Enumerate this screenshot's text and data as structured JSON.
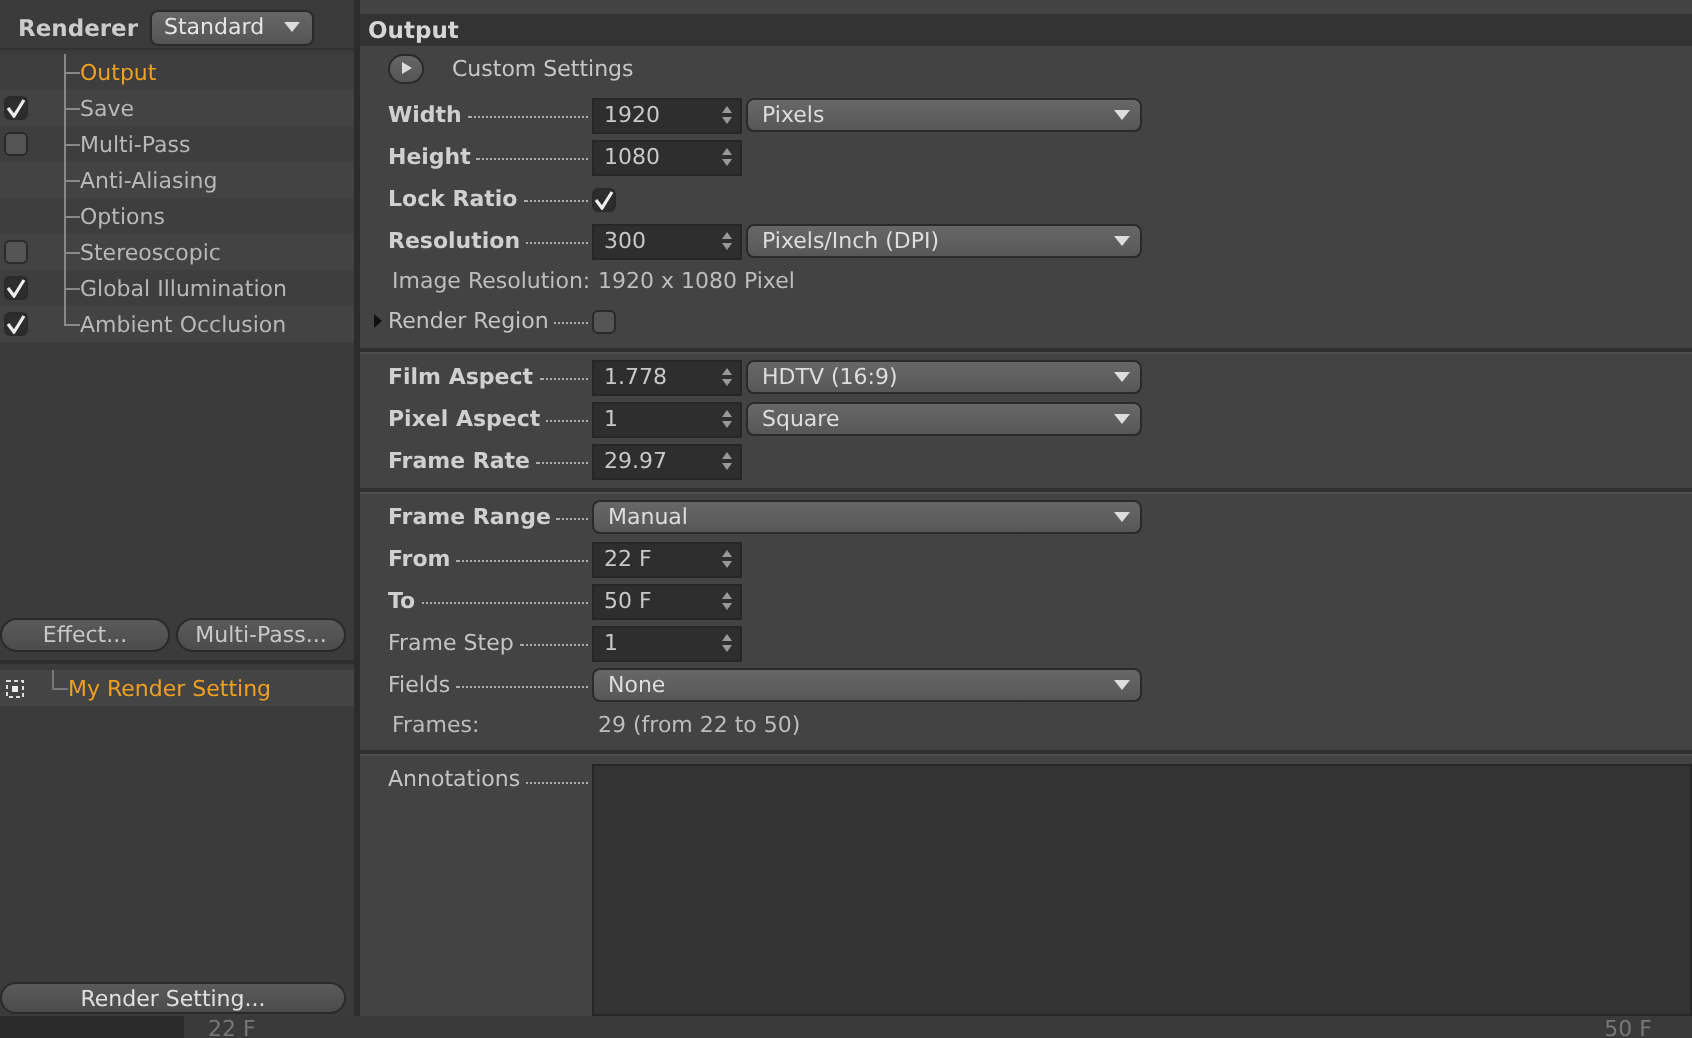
{
  "renderer": {
    "label": "Renderer",
    "value": "Standard"
  },
  "tree": [
    {
      "label": "Output",
      "selected": true
    },
    {
      "label": "Save",
      "selected": false,
      "checked": true
    },
    {
      "label": "Multi-Pass",
      "selected": false,
      "checked": false
    },
    {
      "label": "Anti-Aliasing",
      "selected": false
    },
    {
      "label": "Options",
      "selected": false
    },
    {
      "label": "Stereoscopic",
      "selected": false,
      "checked": false
    },
    {
      "label": "Global Illumination",
      "selected": false,
      "checked": true
    },
    {
      "label": "Ambient Occlusion",
      "selected": false,
      "checked": true
    }
  ],
  "buttons": [
    "Effect...",
    "Multi-Pass..."
  ],
  "settings": [
    {
      "label": "My Render Setting",
      "selected": true
    }
  ],
  "render_setting_button": "Render Setting...",
  "panel": {
    "title": "Output",
    "custom_settings": "Custom Settings",
    "sections": [
      [
        {
          "kind": "spin",
          "label": "Width",
          "bold": true,
          "value": "1920",
          "dropdown": "Pixels"
        },
        {
          "kind": "spin",
          "label": "Height",
          "bold": true,
          "value": "1080"
        },
        {
          "kind": "check",
          "label": "Lock Ratio",
          "bold": true,
          "checked": true
        },
        {
          "kind": "spin",
          "label": "Resolution",
          "bold": true,
          "value": "300",
          "dropdown": "Pixels/Inch (DPI)"
        },
        {
          "kind": "info",
          "label": "Image Resolution:",
          "value": "1920 x 1080 Pixel"
        },
        {
          "kind": "expander",
          "label": "Render Region",
          "checked": false
        }
      ],
      [
        {
          "kind": "spin",
          "label": "Film Aspect",
          "bold": true,
          "value": "1.778",
          "dropdown": "HDTV (16:9)"
        },
        {
          "kind": "spin",
          "label": "Pixel Aspect",
          "bold": true,
          "value": "1",
          "dropdown": "Square"
        },
        {
          "kind": "spin",
          "label": "Frame Rate",
          "bold": true,
          "value": "29.97"
        }
      ],
      [
        {
          "kind": "dropdown",
          "label": "Frame Range",
          "bold": true,
          "value": "Manual"
        },
        {
          "kind": "spin",
          "label": "From",
          "bold": true,
          "value": "22 F"
        },
        {
          "kind": "spin",
          "label": "To",
          "bold": true,
          "value": "50 F"
        },
        {
          "kind": "spin",
          "label": "Frame Step",
          "bold": false,
          "value": "1"
        },
        {
          "kind": "dropdown",
          "label": "Fields",
          "bold": false,
          "value": "None"
        },
        {
          "kind": "info",
          "label": "Frames:",
          "value": "29 (from 22 to 50)"
        }
      ],
      [
        {
          "kind": "textarea",
          "label": "Annotations",
          "bold": false
        }
      ]
    ]
  },
  "timeline": {
    "start": "22 F",
    "end": "50 F"
  }
}
